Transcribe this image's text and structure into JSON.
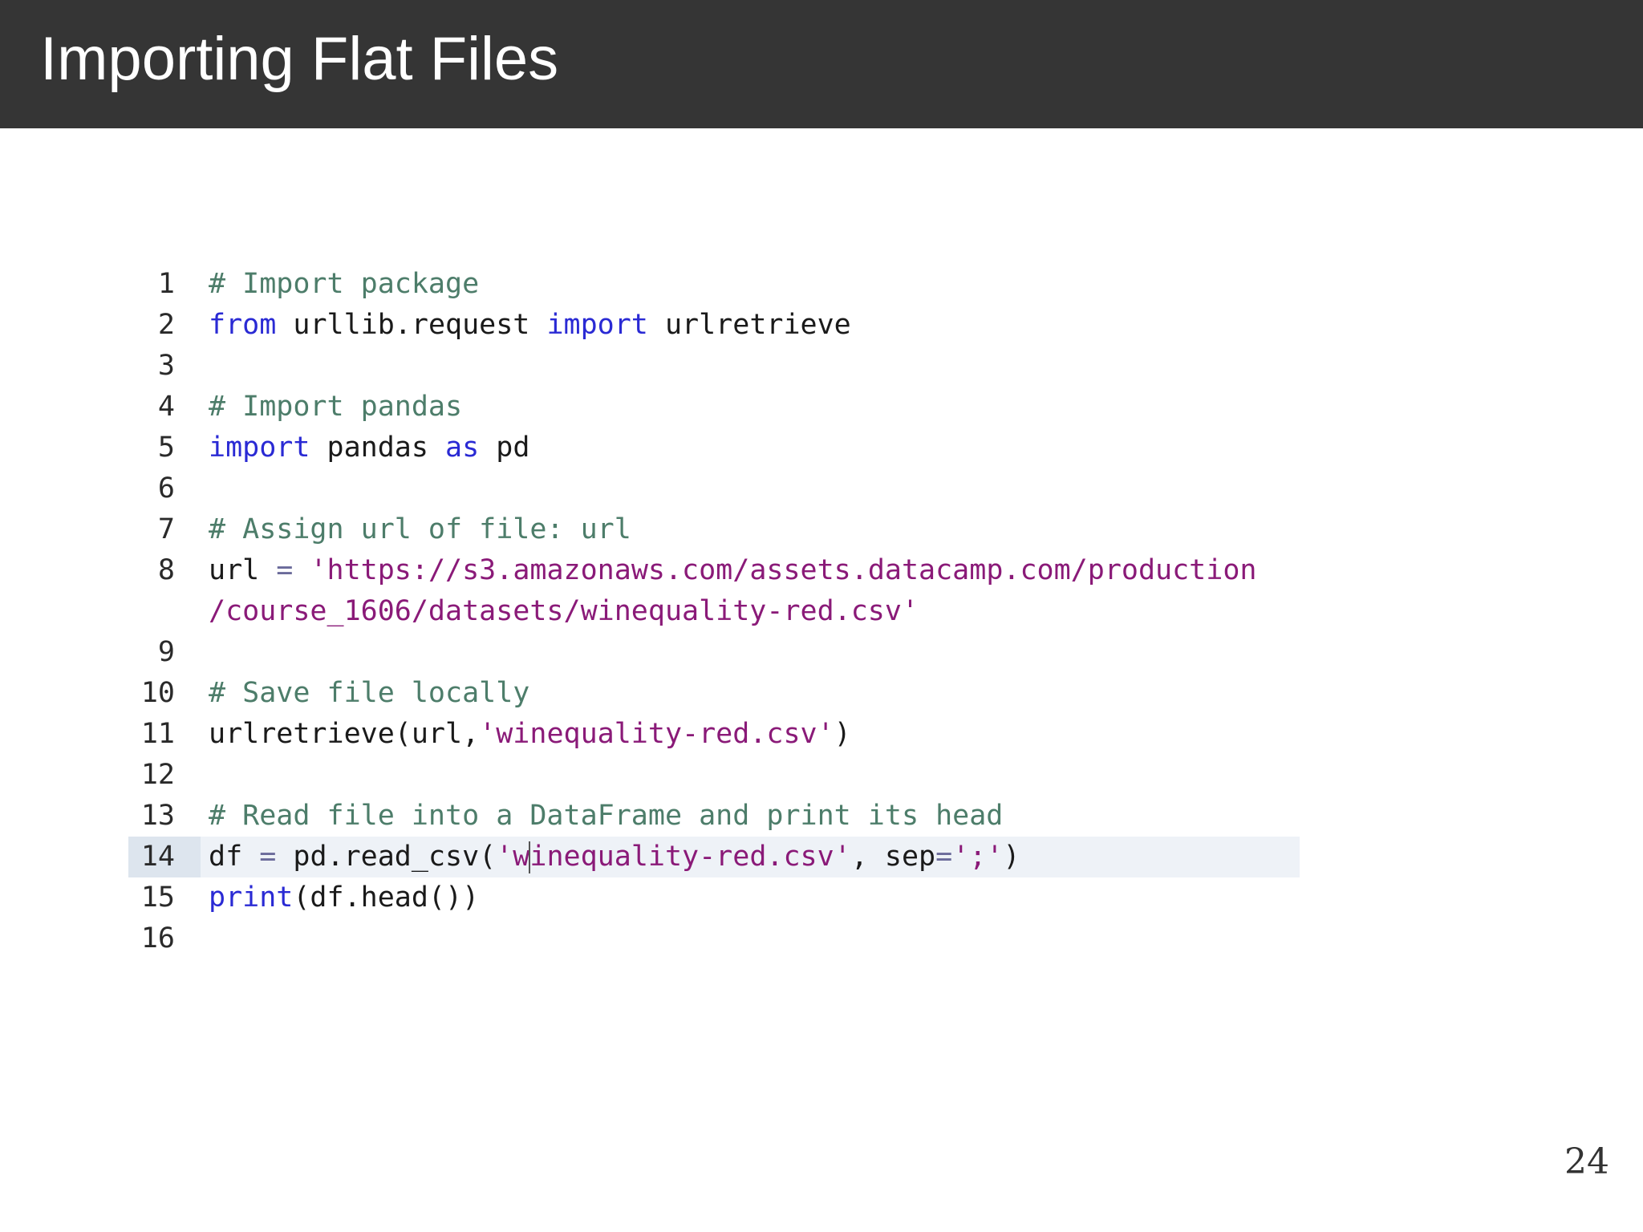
{
  "slide": {
    "title": "Importing Flat Files",
    "page_number": "24"
  },
  "code": {
    "lines": [
      {
        "num": "1",
        "tokens": [
          [
            "comment",
            "# Import package"
          ]
        ]
      },
      {
        "num": "2",
        "tokens": [
          [
            "kw",
            "from"
          ],
          [
            "plain",
            " urllib.request "
          ],
          [
            "kw",
            "import"
          ],
          [
            "plain",
            " urlretrieve"
          ]
        ]
      },
      {
        "num": "3",
        "tokens": []
      },
      {
        "num": "4",
        "tokens": [
          [
            "comment",
            "# Import pandas"
          ]
        ]
      },
      {
        "num": "5",
        "tokens": [
          [
            "kw",
            "import"
          ],
          [
            "plain",
            " pandas "
          ],
          [
            "kw",
            "as"
          ],
          [
            "plain",
            " pd"
          ]
        ]
      },
      {
        "num": "6",
        "tokens": []
      },
      {
        "num": "7",
        "tokens": [
          [
            "comment",
            "# Assign url of file: url"
          ]
        ]
      },
      {
        "num": "8",
        "tokens": [
          [
            "plain",
            "url "
          ],
          [
            "op",
            "="
          ],
          [
            "plain",
            " "
          ],
          [
            "str",
            "'https://s3.amazonaws.com/assets.datacamp.com/production"
          ]
        ]
      },
      {
        "num": "",
        "tokens": [
          [
            "str",
            "/course_1606/datasets/winequality-red.csv'"
          ]
        ]
      },
      {
        "num": "9",
        "tokens": []
      },
      {
        "num": "10",
        "tokens": [
          [
            "comment",
            "# Save file locally"
          ]
        ]
      },
      {
        "num": "11",
        "tokens": [
          [
            "plain",
            "urlretrieve(url,"
          ],
          [
            "str",
            "'winequality-red.csv'"
          ],
          [
            "plain",
            ")"
          ]
        ]
      },
      {
        "num": "12",
        "tokens": []
      },
      {
        "num": "13",
        "tokens": [
          [
            "comment",
            "# Read file into a DataFrame and print its head"
          ]
        ]
      },
      {
        "num": "14",
        "active": true,
        "tokens": [
          [
            "plain",
            "df "
          ],
          [
            "op",
            "="
          ],
          [
            "plain",
            " pd.read_csv("
          ],
          [
            "str",
            "'w"
          ],
          [
            "cursor",
            ""
          ],
          [
            "str",
            "inequality-red.csv'"
          ],
          [
            "plain",
            ", sep"
          ],
          [
            "op",
            "="
          ],
          [
            "str",
            "';'"
          ],
          [
            "plain",
            ")"
          ]
        ]
      },
      {
        "num": "15",
        "tokens": [
          [
            "kw",
            "print"
          ],
          [
            "plain",
            "(df.head())"
          ]
        ]
      },
      {
        "num": "16",
        "tokens": []
      }
    ]
  }
}
